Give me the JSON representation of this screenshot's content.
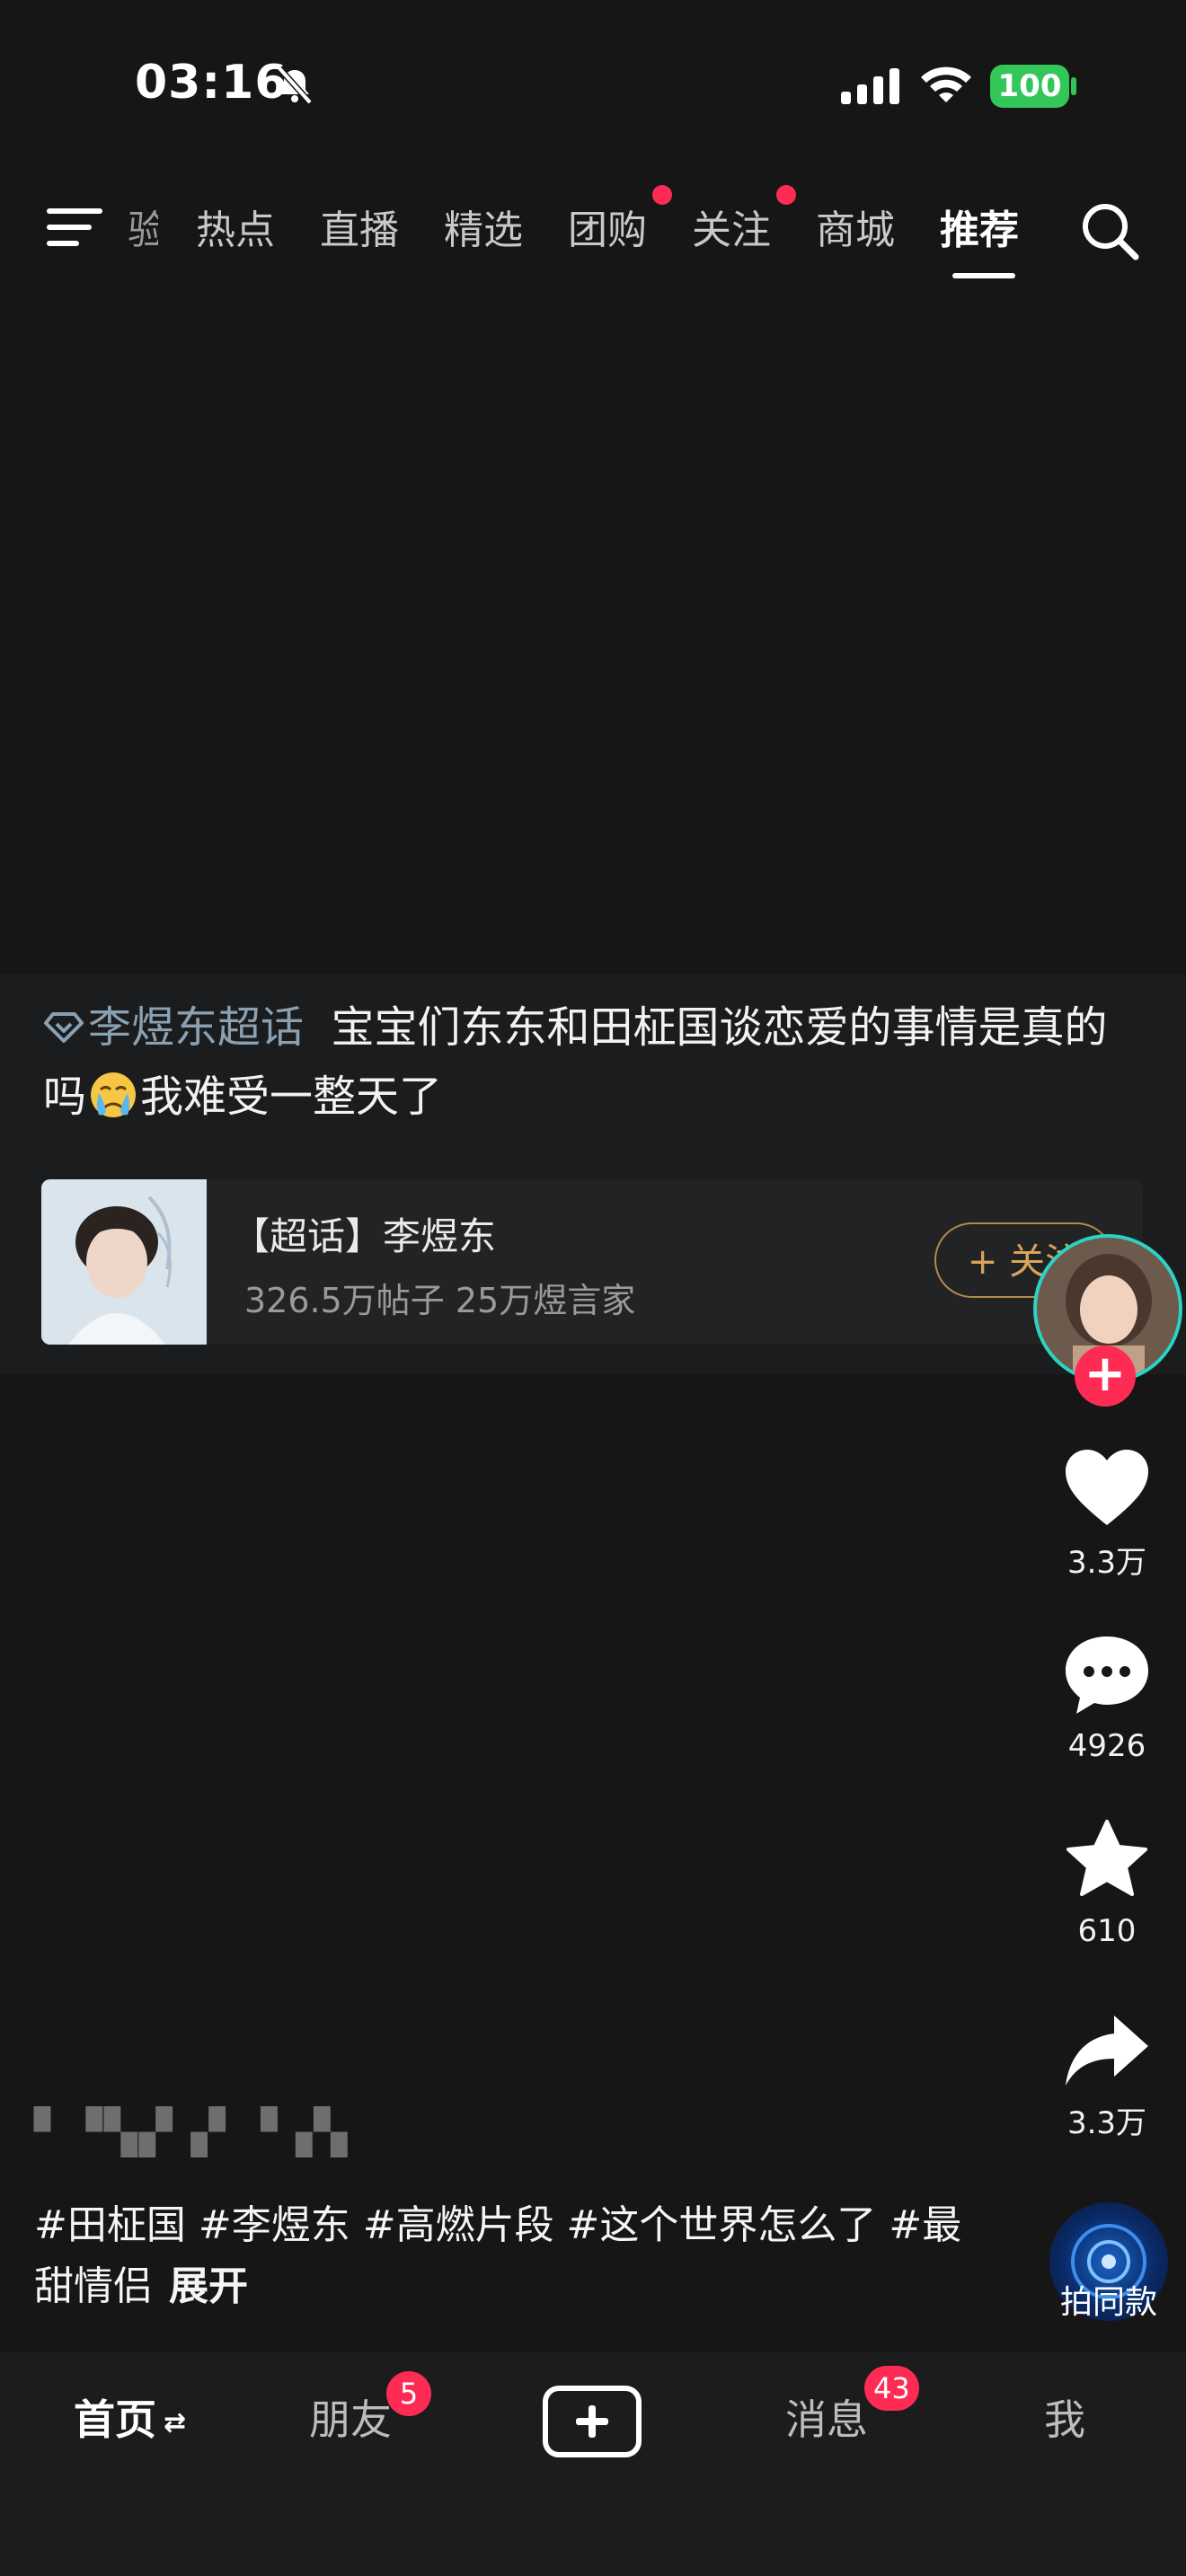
{
  "status_bar": {
    "time": "03:16",
    "battery": "100",
    "battery_color": "#33c759",
    "icons": [
      "bell-slash-icon",
      "cellular-signal-icon",
      "wifi-icon",
      "battery-icon"
    ]
  },
  "top_nav": {
    "partial_tab": "验",
    "tabs": [
      {
        "label": "热点",
        "dot": false
      },
      {
        "label": "直播",
        "dot": false
      },
      {
        "label": "精选",
        "dot": false
      },
      {
        "label": "团购",
        "dot": true
      },
      {
        "label": "关注",
        "dot": true
      },
      {
        "label": "商城",
        "dot": false
      },
      {
        "label": "推荐",
        "dot": false,
        "active": true
      }
    ],
    "icons": [
      "menu-icon",
      "search-icon"
    ],
    "accent_dot_color": "#fe2c55"
  },
  "post": {
    "topic_tag": "李煜东超话",
    "caption_part1": "宝宝们东东和田柾国谈恋爱的事情是真的吗",
    "caption_part2": "我难受一整天了",
    "emoji": "crying-face-emoji",
    "supertopic_card": {
      "title": "【超话】李煜东",
      "stats": "326.5万帖子 25万煜言家",
      "follow_label": "+ 关注"
    }
  },
  "actions": {
    "like_count": "3.3万",
    "comment_count": "4926",
    "favorite_count": "610",
    "share_count": "3.3万",
    "same_style_label": "拍同款"
  },
  "description": {
    "hashtags": "#田柾国 #李煜东 #高燃片段 #这个世界怎么了 #最甜情侣",
    "expand_label": "展开"
  },
  "bottom_nav": {
    "home": "首页",
    "friends": "朋友",
    "friends_badge": "5",
    "messages": "消息",
    "messages_badge": "43",
    "me": "我",
    "badge_color": "#fe2c55"
  }
}
